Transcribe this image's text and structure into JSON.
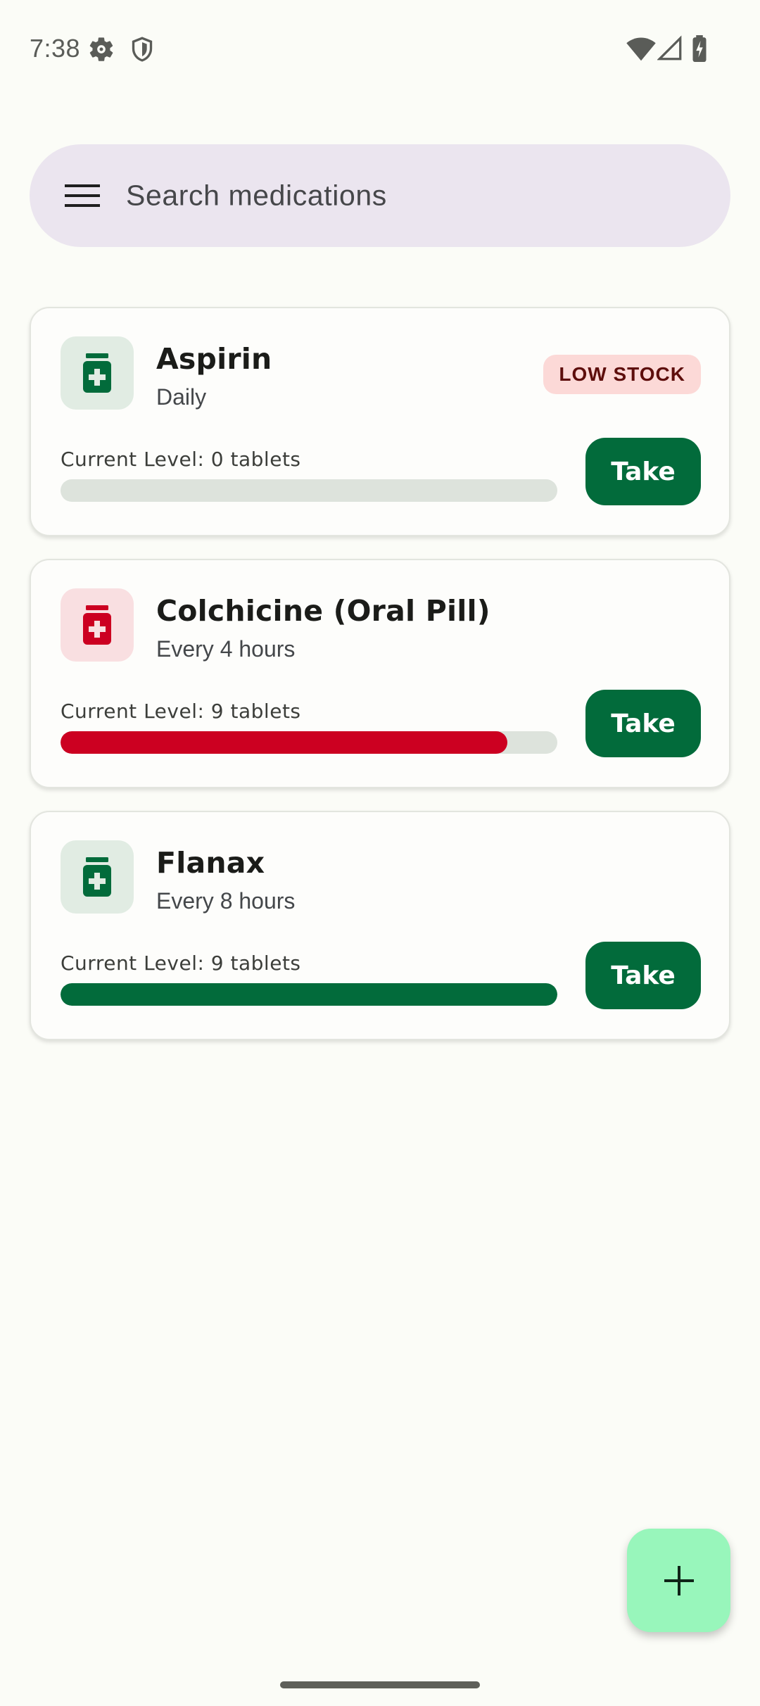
{
  "status_bar": {
    "time": "7:38",
    "icons": [
      "gear-icon",
      "shield-icon",
      "wifi-icon",
      "cellular-icon",
      "battery-charging-icon"
    ]
  },
  "search": {
    "placeholder": "Search medications"
  },
  "colors": {
    "primary": "#026b3b",
    "danger": "#cc0021",
    "fab_bg": "#98f6bb",
    "search_bg": "#ebe5ef",
    "track": "#dde3dc"
  },
  "medications": [
    {
      "name": "Aspirin",
      "frequency": "Daily",
      "badge": "LOW STOCK",
      "level_label": "Current Level: 0 tablets",
      "level_fraction": 0.0,
      "status": "green",
      "take_label": "Take"
    },
    {
      "name": "Colchicine (Oral Pill)",
      "frequency": "Every 4 hours",
      "badge": "",
      "level_label": "Current Level: 9 tablets",
      "level_fraction": 0.9,
      "status": "red",
      "take_label": "Take"
    },
    {
      "name": "Flanax",
      "frequency": "Every 8 hours",
      "badge": "",
      "level_label": "Current Level: 9 tablets",
      "level_fraction": 1.0,
      "status": "green",
      "take_label": "Take"
    }
  ],
  "fab": {
    "icon": "plus-icon"
  }
}
